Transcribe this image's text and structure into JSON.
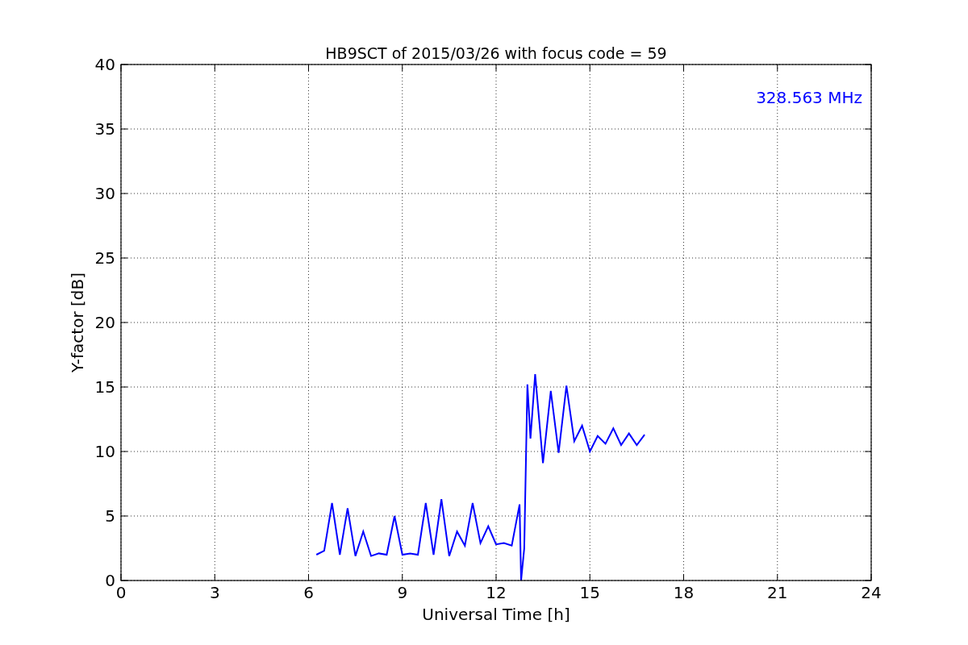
{
  "chart_data": {
    "type": "line",
    "title": "HB9SCT of 2015/03/26 with focus code = 59",
    "xlabel": "Universal Time [h]",
    "ylabel": "Y-factor [dB]",
    "x": [
      6.25,
      6.5,
      6.75,
      7.0,
      7.25,
      7.5,
      7.75,
      8.0,
      8.25,
      8.5,
      8.75,
      9.0,
      9.25,
      9.5,
      9.75,
      10.0,
      10.25,
      10.5,
      10.75,
      11.0,
      11.25,
      11.5,
      11.75,
      12.0,
      12.25,
      12.5,
      12.75,
      12.8,
      12.9,
      13.0,
      13.1,
      13.25,
      13.5,
      13.75,
      14.0,
      14.25,
      14.5,
      14.75,
      15.0,
      15.25,
      15.5,
      15.75,
      16.0,
      16.25,
      16.5,
      16.75
    ],
    "series": [
      {
        "color": "#0000ff",
        "values": [
          2.0,
          2.3,
          6.0,
          2.0,
          5.6,
          1.9,
          3.8,
          1.9,
          2.1,
          2.0,
          5.0,
          2.0,
          2.1,
          2.0,
          6.0,
          2.0,
          6.3,
          1.9,
          3.8,
          2.7,
          6.0,
          2.9,
          4.2,
          2.8,
          2.9,
          2.7,
          5.9,
          0.0,
          2.5,
          15.2,
          11.0,
          16.0,
          9.1,
          14.7,
          9.9,
          15.1,
          10.8,
          12.0,
          10.0,
          11.2,
          10.6,
          11.8,
          10.5,
          11.4,
          10.5,
          11.3
        ]
      }
    ],
    "xlim": [
      0,
      24
    ],
    "ylim": [
      0,
      40
    ],
    "xticks": [
      0,
      3,
      6,
      9,
      12,
      15,
      18,
      21,
      24
    ],
    "yticks": [
      0,
      5,
      10,
      15,
      20,
      25,
      30,
      35,
      40
    ],
    "grid": true,
    "annotations": [
      "328.563 MHz"
    ]
  }
}
